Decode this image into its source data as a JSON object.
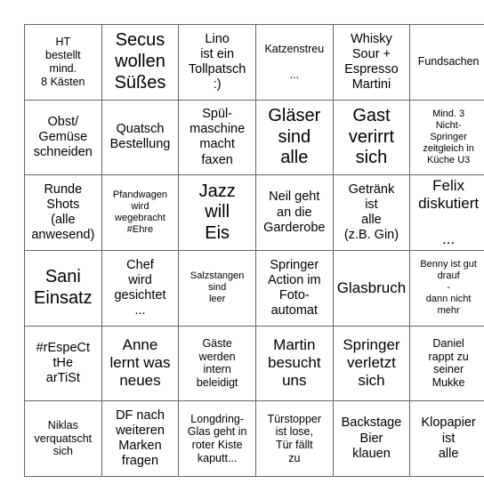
{
  "card": {
    "type": "bingo-card",
    "rows": 6,
    "columns": 6,
    "border_color": "#666666",
    "background_color": "#ffffff",
    "text_color": "#000000",
    "cells": [
      [
        {
          "text": "HT\nbestellt\nmind.\n8 Kästen",
          "size": "sm"
        },
        {
          "text": "Secus\nwollen\nSüßes",
          "size": "xl"
        },
        {
          "text": "Lino\nist ein\nTollpatsch\n:)",
          "size": "md"
        },
        {
          "text": "Katzenstreu\n\n...",
          "size": "sm"
        },
        {
          "text": "Whisky\nSour +\nEspresso\nMartini",
          "size": "md"
        },
        {
          "text": "Fundsachen",
          "size": "sm"
        }
      ],
      [
        {
          "text": "Obst/\nGemüse\nschneiden",
          "size": "md"
        },
        {
          "text": "Quatsch\nBestellung",
          "size": "md"
        },
        {
          "text": "Spül-\nmaschine\nmacht\nfaxen",
          "size": "md"
        },
        {
          "text": "Gläser\nsind\nalle",
          "size": "xl"
        },
        {
          "text": "Gast\nverirrt\nsich",
          "size": "xl"
        },
        {
          "text": "Mind. 3\nNicht-\nSpringer\nzeitgleich in\nKüche U3",
          "size": "xs"
        }
      ],
      [
        {
          "text": "Runde\nShots\n(alle\nanwesend)",
          "size": "md"
        },
        {
          "text": "Pfandwagen\nwird\nwegebracht\n#Ehre",
          "size": "xs"
        },
        {
          "text": "Jazz\nwill\nEis",
          "size": "xl"
        },
        {
          "text": "Neil geht\nan die\nGarderobe",
          "size": "md"
        },
        {
          "text": "Getränk\nist\nalle\n(z.B. Gin)",
          "size": "md"
        },
        {
          "text": "Felix\ndiskutiert\n\n...",
          "size": "lg"
        }
      ],
      [
        {
          "text": "Sani\nEinsatz",
          "size": "xl"
        },
        {
          "text": "Chef\nwird\ngesichtet\n...",
          "size": "md"
        },
        {
          "text": "Salzstangen\nsind\nleer",
          "size": "xs"
        },
        {
          "text": "Springer\nAction im\nFoto-\nautomat",
          "size": "md"
        },
        {
          "text": "Glasbruch",
          "size": "lg"
        },
        {
          "text": "Benny ist gut\ndrauf\n-\ndann nicht\nmehr",
          "size": "xs"
        }
      ],
      [
        {
          "text": "#rEspeCt\ntHe\narTiSt",
          "size": "md"
        },
        {
          "text": "Anne\nlernt was\nneues",
          "size": "lg"
        },
        {
          "text": "Gäste\nwerden\nintern\nbeleidigt",
          "size": "sm"
        },
        {
          "text": "Martin\nbesucht\nuns",
          "size": "lg"
        },
        {
          "text": "Springer\nverletzt\nsich",
          "size": "lg"
        },
        {
          "text": "Daniel\nrappt zu\nseiner\nMukke",
          "size": "sm"
        }
      ],
      [
        {
          "text": "Niklas\nverquatscht\nsich",
          "size": "sm"
        },
        {
          "text": "DF nach\nweiteren\nMarken\nfragen",
          "size": "md"
        },
        {
          "text": "Longdring-\nGlas geht in\nroter Kiste\nkaputt...",
          "size": "sm"
        },
        {
          "text": "Türstopper\nist lose,\nTür fällt\nzu",
          "size": "sm"
        },
        {
          "text": "Backstage\nBier\nklauen",
          "size": "md"
        },
        {
          "text": "Klopapier\nist\nalle",
          "size": "md"
        }
      ]
    ]
  }
}
